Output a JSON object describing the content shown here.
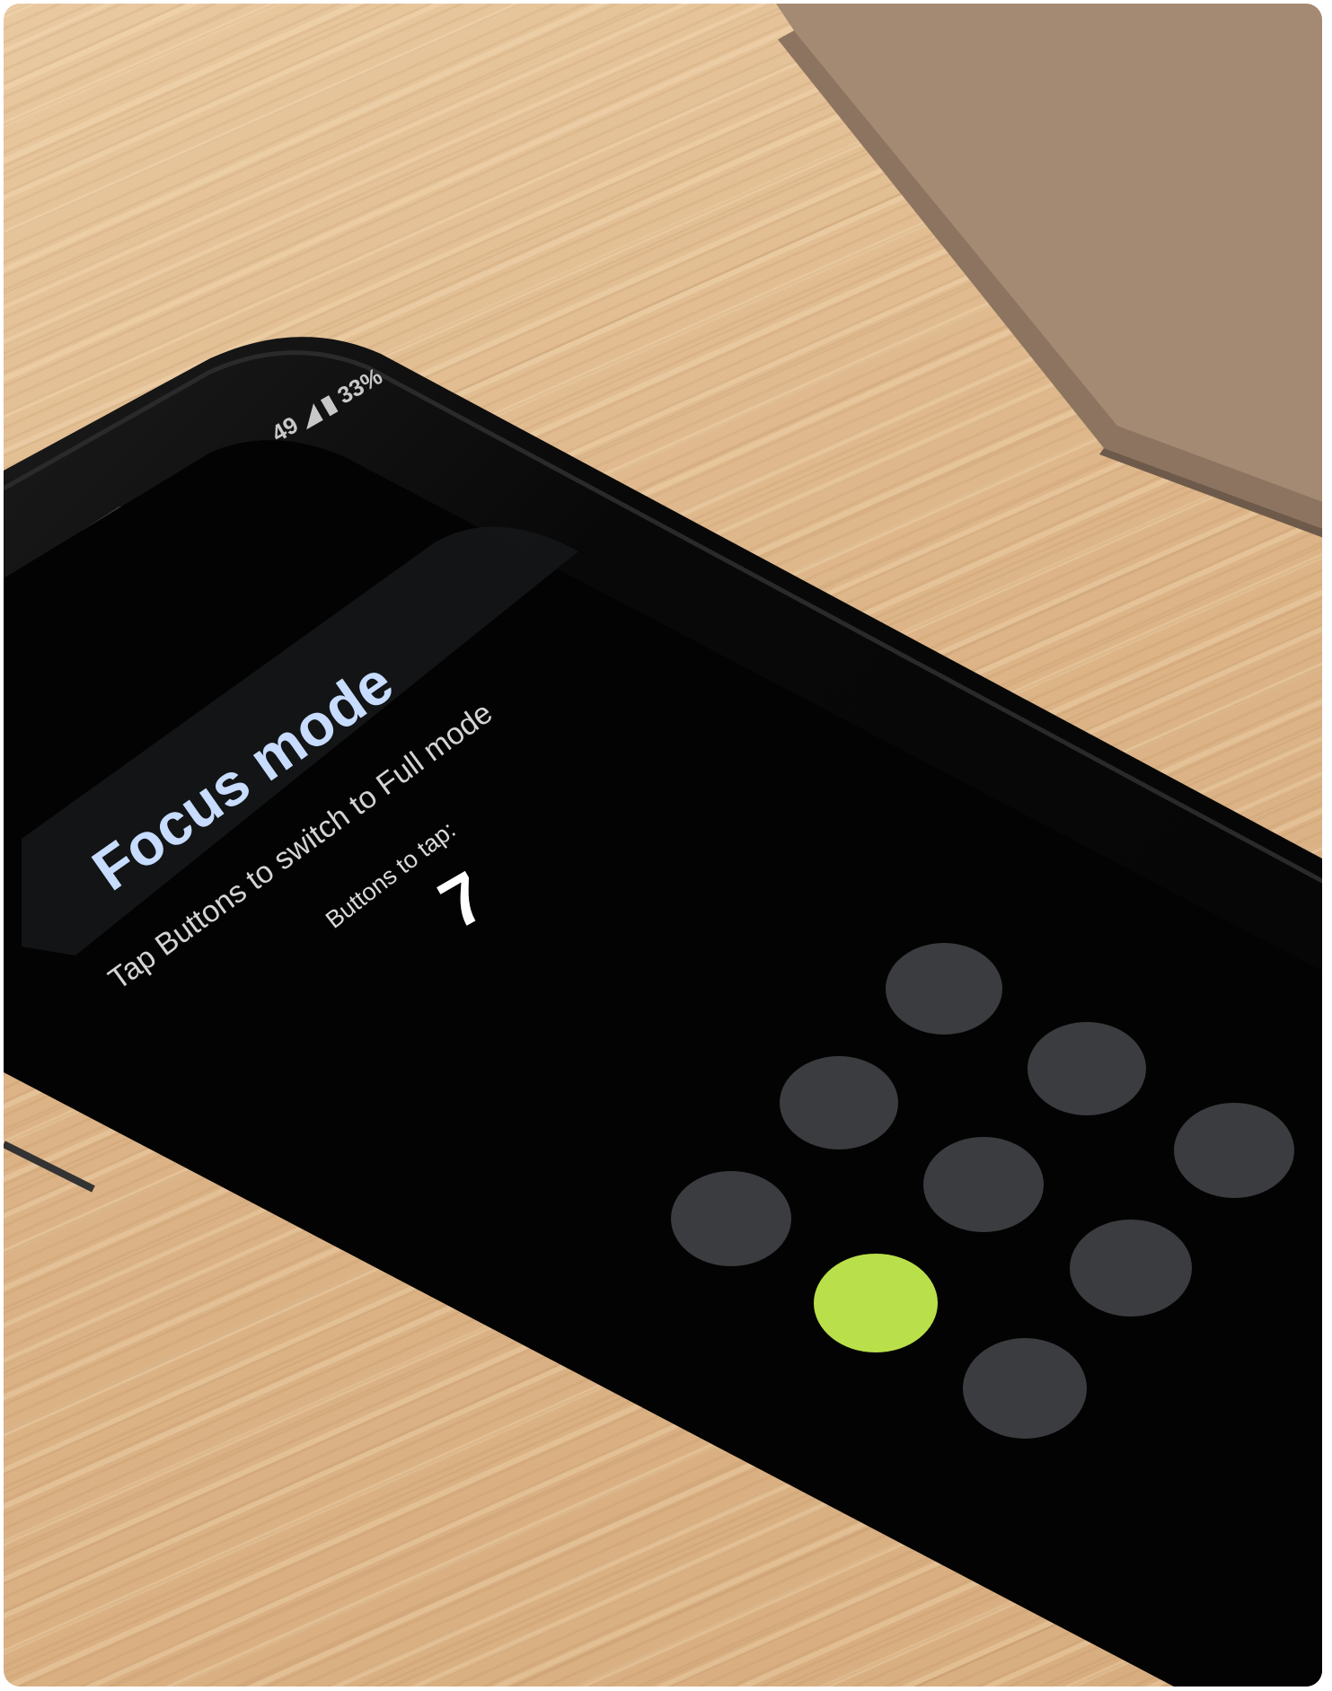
{
  "phone": {
    "status_bar": "49 ◢ ▮ 33%",
    "title": "Focus mode",
    "subtitle": "Tap Buttons to switch to Full mode",
    "tap_label": "Buttons to tap:",
    "tap_count": "7"
  },
  "button_grid": {
    "rows": 3,
    "columns": 3,
    "active_index": 6,
    "active_color": "#b9e04a",
    "inactive_color": "#3b3c3f"
  },
  "colors": {
    "wood": "#dcb487",
    "screen": "#040404",
    "banner": "#17191b",
    "title": "#cfe0ff"
  }
}
